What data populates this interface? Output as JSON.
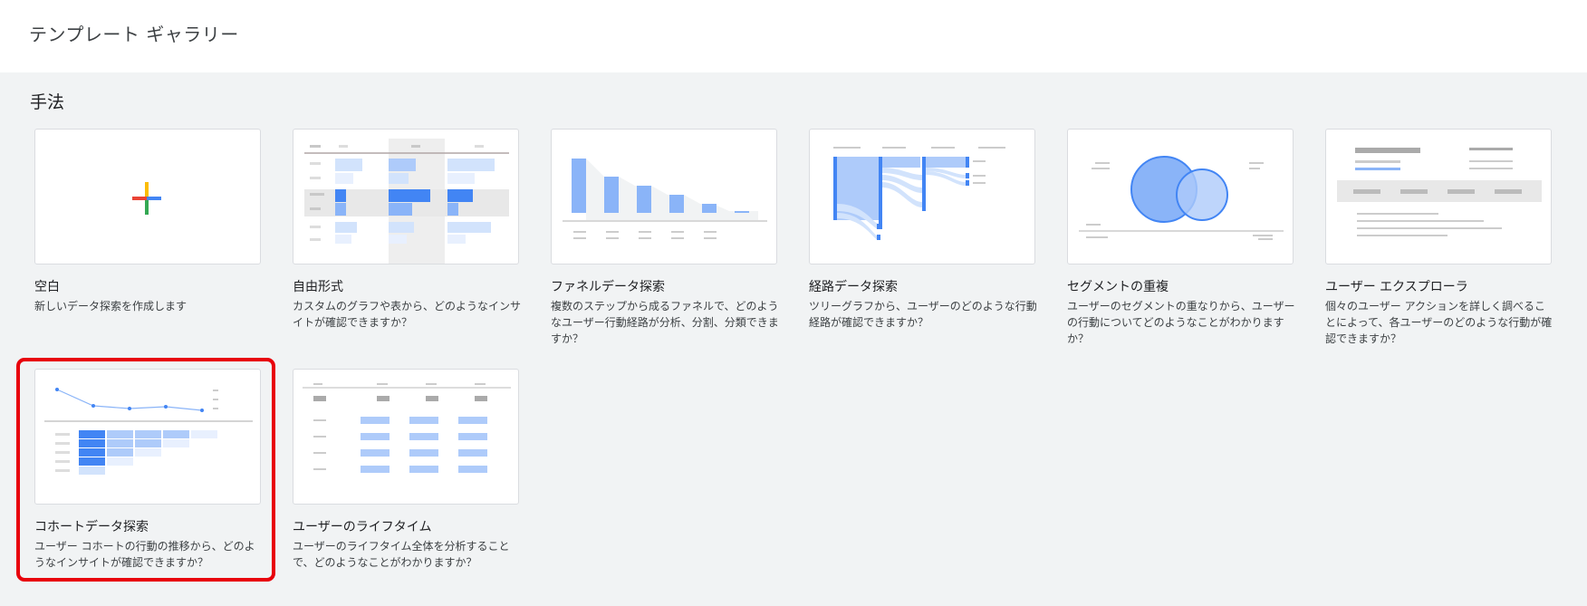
{
  "header": {
    "title": "テンプレート ギャラリー"
  },
  "section": {
    "title": "手法"
  },
  "cards": [
    {
      "title": "空白",
      "desc": "新しいデータ探索を作成します"
    },
    {
      "title": "自由形式",
      "desc": "カスタムのグラフや表から、どのようなインサイトが確認できますか？"
    },
    {
      "title": "ファネルデータ探索",
      "desc": "複数のステップから成るファネルで、どのようなユーザー行動経路が分析、分割、分類できますか？"
    },
    {
      "title": "経路データ探索",
      "desc": "ツリーグラフから、ユーザーのどのような行動経路が確認できますか？"
    },
    {
      "title": "セグメントの重複",
      "desc": "ユーザーのセグメントの重なりから、ユーザーの行動についてどのようなことがわかりますか？"
    },
    {
      "title": "ユーザー エクスプローラ",
      "desc": "個々のユーザー アクションを詳しく調べることによって、各ユーザーのどのような行動が確認できますか？"
    },
    {
      "title": "コホートデータ探索",
      "desc": "ユーザー コホートの行動の推移から、どのようなインサイトが確認できますか？"
    },
    {
      "title": "ユーザーのライフタイム",
      "desc": "ユーザーのライフタイム全体を分析することで、どのようなことがわかりますか？"
    }
  ],
  "selected_card": "コホートデータ探索",
  "colors": {
    "accent_blue": "#4285f4",
    "light_blue": "#aecbfa",
    "pale_blue": "#e8f0fe",
    "highlight_red": "#e8000b"
  },
  "icons": {
    "blank": "plus-icon",
    "free_form": "free-form-table-icon",
    "funnel": "funnel-chart-icon",
    "path": "path-tree-icon",
    "segment_overlap": "venn-diagram-icon",
    "user_explorer": "user-explorer-icon",
    "cohort": "cohort-table-icon",
    "lifetime": "lifetime-table-icon"
  }
}
